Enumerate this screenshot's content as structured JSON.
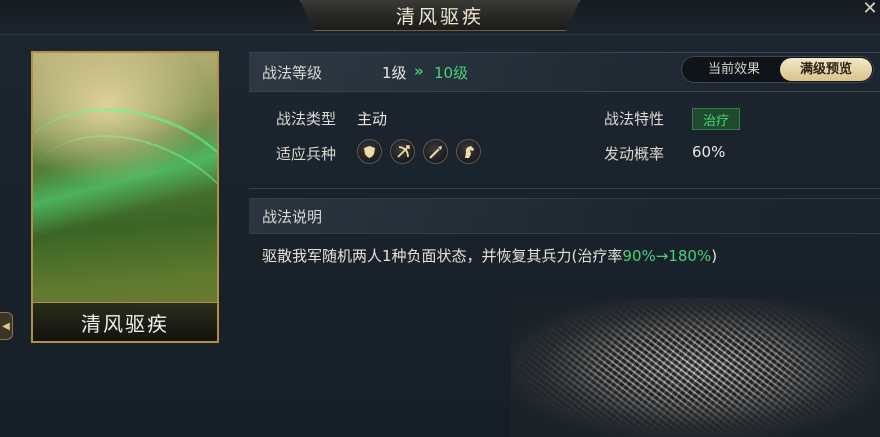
{
  "header": {
    "title": "清风驱疾",
    "close_symbol": "✕"
  },
  "card": {
    "name": "清风驱疾"
  },
  "level": {
    "label": "战法等级",
    "current": "1级",
    "arrow": "»",
    "max": "10级",
    "toggle": {
      "current_label": "当前效果",
      "max_label": "满级预览",
      "selected": "满级预览"
    }
  },
  "stats": {
    "type_label": "战法类型",
    "type_value": "主动",
    "trait_label": "战法特性",
    "trait_value": "治疗",
    "units_label": "适应兵种",
    "units": [
      "shield-icon",
      "crossbow-icon",
      "spear-icon",
      "horse-icon"
    ],
    "chance_label": "发动概率",
    "chance_value": "60%"
  },
  "description": {
    "label": "战法说明",
    "text_prefix": "驱散我军随机两人1种负面状态，并恢复其兵力(治疗率",
    "heal_range": "90%→180%",
    "text_suffix": ")"
  },
  "colors": {
    "accent_green": "#49d07a",
    "gold": "#b58d45"
  }
}
